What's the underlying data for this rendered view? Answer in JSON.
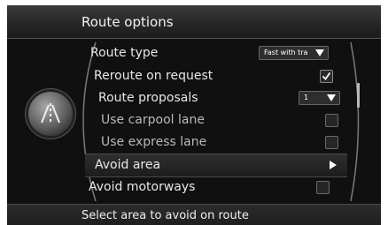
{
  "header": {
    "title": "Route options"
  },
  "footer": {
    "hint": "Select area to avoid on route"
  },
  "menu": {
    "route_type": {
      "label": "Route type",
      "value": "Fast with tra"
    },
    "reroute_on_request": {
      "label": "Reroute on request",
      "checked": true
    },
    "route_proposals": {
      "label": "Route proposals",
      "value": "1"
    },
    "use_carpool_lane": {
      "label": "Use carpool lane",
      "checked": false
    },
    "use_express_lane": {
      "label": "Use express lane",
      "checked": false
    },
    "avoid_area": {
      "label": "Avoid area",
      "selected": true
    },
    "avoid_motorways": {
      "label": "Avoid motorways",
      "checked": false
    }
  },
  "icons": {
    "controller": "road-knob-icon"
  }
}
